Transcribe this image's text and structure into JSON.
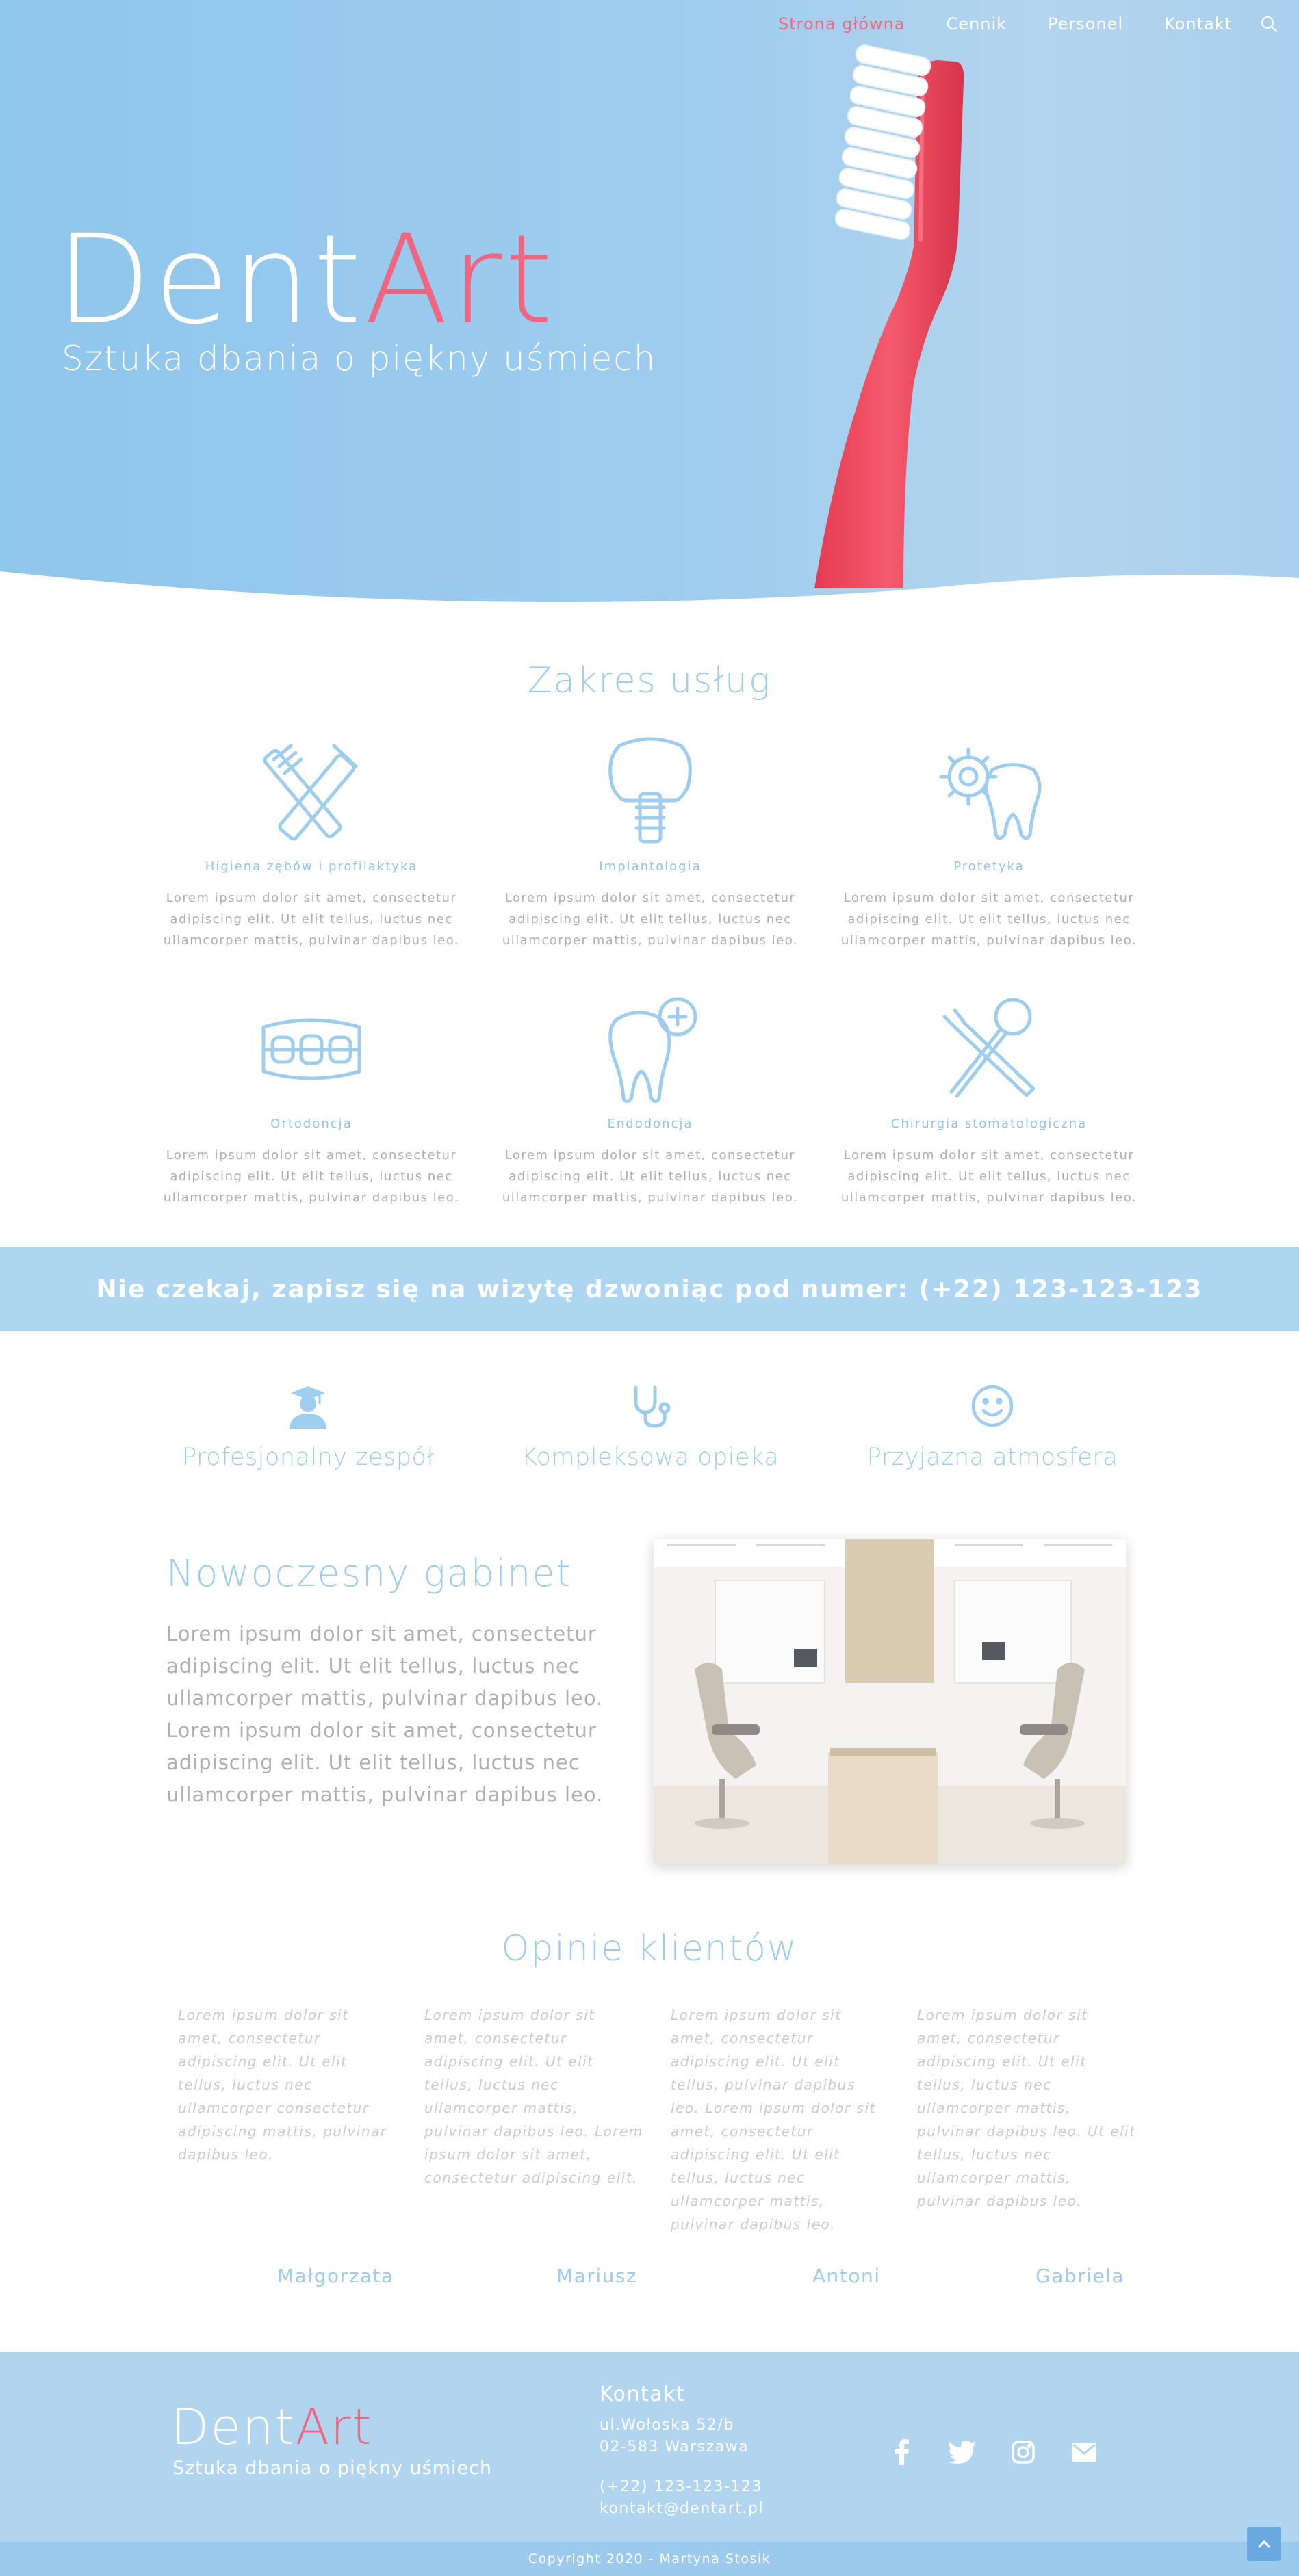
{
  "nav": {
    "items": [
      {
        "label": "Strona główna",
        "active": true
      },
      {
        "label": "Cennik",
        "active": false
      },
      {
        "label": "Personel",
        "active": false
      },
      {
        "label": "Kontakt",
        "active": false
      }
    ],
    "search_icon": "search-icon"
  },
  "hero": {
    "brand_part1": "Dent",
    "brand_part2": "Art",
    "subtitle": "Sztuka dbania o piękny uśmiech"
  },
  "services": {
    "title": "Zakres usług",
    "items": [
      {
        "title": "Higiena zębów i profilaktyka",
        "text": "Lorem ipsum dolor sit amet, consectetur adipiscing elit. Ut elit tellus, luctus nec ullamcorper mattis, pulvinar dapibus leo.",
        "icon": "toothbrush-toothpaste-icon"
      },
      {
        "title": "Implantologia",
        "text": "Lorem ipsum dolor sit amet, consectetur adipiscing elit. Ut elit tellus, luctus nec ullamcorper mattis, pulvinar dapibus leo.",
        "icon": "implant-icon"
      },
      {
        "title": "Protetyka",
        "text": "Lorem ipsum dolor sit amet, consectetur adipiscing elit. Ut elit tellus, luctus nec ullamcorper mattis, pulvinar dapibus leo.",
        "icon": "tooth-gear-icon"
      },
      {
        "title": "Ortodoncja",
        "text": "Lorem ipsum dolor sit amet, consectetur adipiscing elit. Ut elit tellus, luctus nec ullamcorper mattis, pulvinar dapibus leo.",
        "icon": "braces-icon"
      },
      {
        "title": "Endodoncja",
        "text": "Lorem ipsum dolor sit amet, consectetur adipiscing elit. Ut elit tellus, luctus nec ullamcorper mattis, pulvinar dapibus leo.",
        "icon": "tooth-plus-icon"
      },
      {
        "title": "Chirurgia stomatologiczna",
        "text": "Lorem ipsum dolor sit amet, consectetur adipiscing elit. Ut elit tellus, luctus nec ullamcorper mattis, pulvinar dapibus leo.",
        "icon": "dental-tools-icon"
      }
    ]
  },
  "cta": {
    "text": "Nie czekaj, zapisz się na wizytę dzwoniąc pod numer: (+22) 123-123-123"
  },
  "features": [
    {
      "label": "Profesjonalny zespół",
      "icon": "graduate-icon"
    },
    {
      "label": "Kompleksowa opieka",
      "icon": "stethoscope-icon"
    },
    {
      "label": "Przyjazna atmosfera",
      "icon": "smiley-icon"
    }
  ],
  "office": {
    "title": "Nowoczesny gabinet",
    "text": "Lorem ipsum dolor sit amet, consectetur adipiscing elit. Ut elit tellus, luctus nec ullamcorper mattis, pulvinar dapibus leo. Lorem ipsum dolor sit amet, consectetur adipiscing elit. Ut elit tellus, luctus nec ullamcorper mattis, pulvinar dapibus leo."
  },
  "reviews": {
    "title": "Opinie klientów",
    "items": [
      {
        "text": "Lorem ipsum dolor sit amet, consectetur adipiscing elit. Ut elit tellus, luctus nec ullamcorper consectetur adipiscing mattis, pulvinar dapibus leo.",
        "name": "Małgorzata"
      },
      {
        "text": "Lorem ipsum dolor sit amet, consectetur adipiscing elit. Ut elit tellus, luctus nec ullamcorper mattis, pulvinar dapibus leo. Lorem ipsum dolor sit amet, consectetur adipiscing elit.",
        "name": "Mariusz"
      },
      {
        "text": "Lorem ipsum dolor sit amet, consectetur adipiscing elit. Ut elit tellus,  pulvinar dapibus leo. Lorem ipsum dolor sit amet, consectetur adipiscing elit. Ut elit tellus, luctus nec ullamcorper mattis, pulvinar dapibus leo.",
        "name": "Antoni"
      },
      {
        "text": "Lorem ipsum dolor sit amet, consectetur adipiscing elit. Ut elit tellus, luctus nec ullamcorper mattis, pulvinar dapibus leo. Ut elit tellus, luctus nec ullamcorper mattis, pulvinar dapibus leo.",
        "name": "Gabriela"
      }
    ]
  },
  "footer": {
    "brand_part1": "Dent",
    "brand_part2": "Art",
    "subtitle": "Sztuka dbania o piękny uśmiech",
    "contact_title": "Kontakt",
    "address1": "ul.Wołoska 52/b",
    "address2": "02-583 Warszawa",
    "phone": "(+22) 123-123-123",
    "email": "kontakt@dentart.pl",
    "social": [
      "facebook-icon",
      "twitter-icon",
      "instagram-icon",
      "envelope-icon"
    ],
    "copyright": "Copyright 2020 - Martyna Stosik"
  },
  "colors": {
    "sky": "#9ecdee",
    "accent_pink": "#f06580",
    "cta_bg": "#afd6f0",
    "footer_bg": "#b1d5ef"
  }
}
